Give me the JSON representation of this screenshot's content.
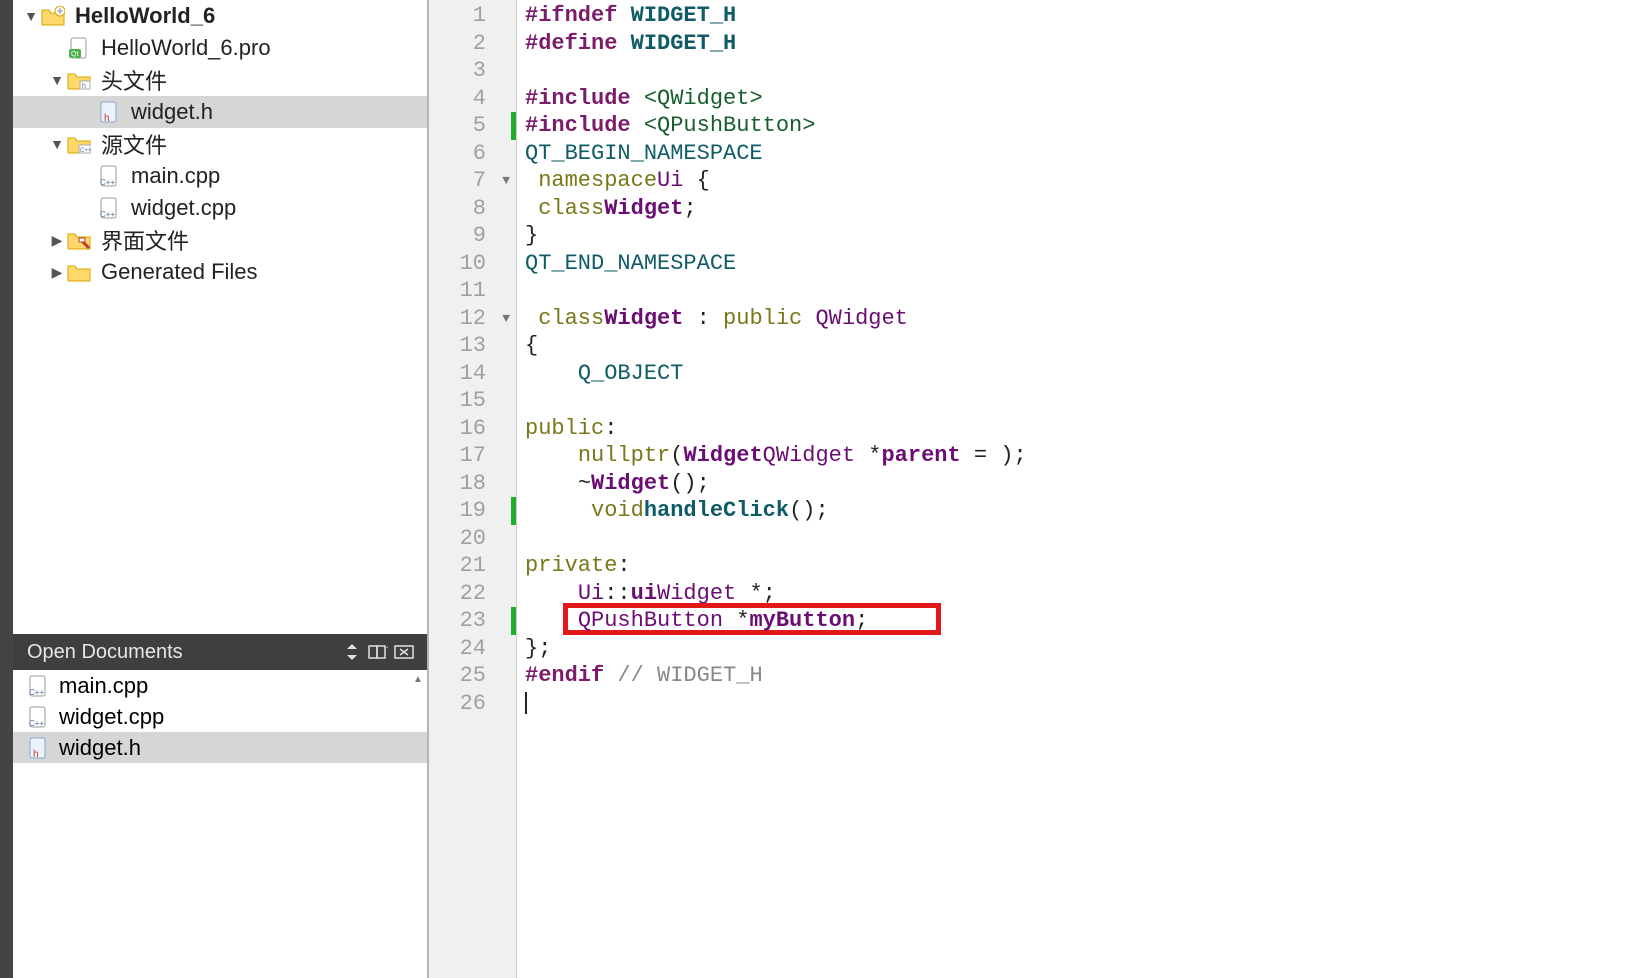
{
  "project": {
    "root": "HelloWorld_6",
    "pro_file": "HelloWorld_6.pro",
    "headers_folder": "头文件",
    "header_file": "widget.h",
    "sources_folder": "源文件",
    "source_main": "main.cpp",
    "source_widget": "widget.cpp",
    "forms_folder": "界面文件",
    "generated_folder": "Generated Files"
  },
  "open_docs": {
    "title": "Open Documents",
    "items": [
      "main.cpp",
      "widget.cpp",
      "widget.h"
    ],
    "selected": "widget.h"
  },
  "editor": {
    "line_count": 26,
    "foldable_lines": [
      7,
      12
    ],
    "changed_lines": [
      5,
      19,
      23
    ],
    "highlight_box_line": 23,
    "lines": {
      "1": {
        "pre": "#ifndef",
        "sp": " ",
        "macro": "WIDGET_H"
      },
      "2": {
        "pre": "#define",
        "sp": " ",
        "macro": "WIDGET_H"
      },
      "4": {
        "pre": "#include",
        "sp": " ",
        "inc": "<QWidget>"
      },
      "5": {
        "pre": "#include",
        "sp": " ",
        "inc": "<QPushButton>"
      },
      "6": {
        "fn": "QT_BEGIN_NAMESPACE"
      },
      "7": {
        "kw": "namespace",
        "sp": " ",
        "type": "Ui",
        "rest": " {"
      },
      "8": {
        "kw": "class",
        "sp": " ",
        "type_b": "Widget",
        "rest": ";"
      },
      "9": {
        "plain": "}"
      },
      "10": {
        "fn": "QT_END_NAMESPACE"
      },
      "12": {
        "kw": "class",
        "sp": " ",
        "type_b": "Widget",
        "rest2": " : ",
        "kw2": "public",
        "sp2": " ",
        "type2": "QWidget"
      },
      "13": {
        "plain": "{"
      },
      "14": {
        "indent": "    ",
        "fn": "Q_OBJECT"
      },
      "16": {
        "kw": "public",
        "rest": ":"
      },
      "17": {
        "indent": "    ",
        "type_b": "Widget",
        "plain1": "(",
        "type2": "QWidget",
        "plain2": " *",
        "type_b2": "parent",
        "plain3": " = ",
        "kw": "nullptr",
        "plain4": ");"
      },
      "18": {
        "indent": "    ",
        "plain1": "~",
        "type_b": "Widget",
        "plain2": "();"
      },
      "19": {
        "indent": "    ",
        "kw": "void",
        "sp": " ",
        "fn_b": "handleClick",
        "plain": "();"
      },
      "21": {
        "kw": "private",
        "rest": ":"
      },
      "22": {
        "indent": "    ",
        "type": "Ui",
        "plain1": "::",
        "type2": "Widget",
        "plain2": " *",
        "type_b": "ui",
        "plain3": ";"
      },
      "23": {
        "indent": "    ",
        "type": "QPushButton",
        "plain1": " *",
        "type_b": "myButton",
        "plain2": ";"
      },
      "24": {
        "plain": "};"
      },
      "25": {
        "pre": "#endif",
        "sp": " ",
        "comment": "// WIDGET_H"
      }
    }
  }
}
